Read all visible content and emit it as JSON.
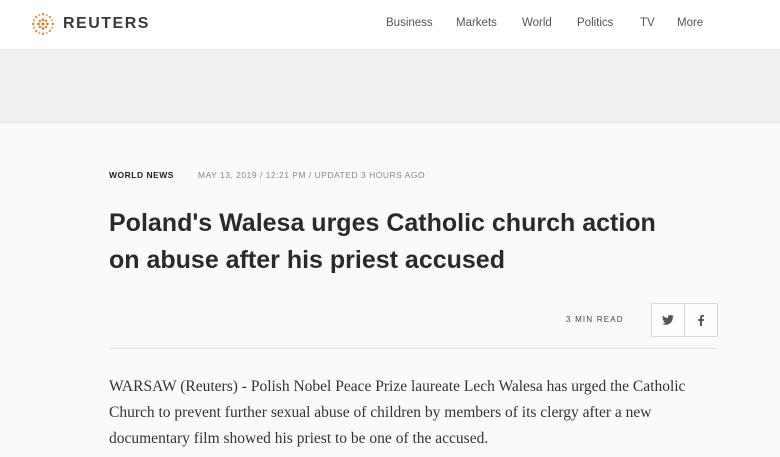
{
  "header": {
    "brand": "REUTERS",
    "nav": [
      "Business",
      "Markets",
      "World",
      "Politics",
      "TV",
      "More"
    ]
  },
  "article": {
    "section": "WORLD NEWS",
    "dateline": "MAY 13, 2019 / 12:21 PM / UPDATED 3 HOURS AGO",
    "headline": "Poland's Walesa urges Catholic church action on abuse after his priest accused",
    "read_time": "3 MIN READ",
    "share_icons": [
      "twitter-icon",
      "facebook-icon"
    ],
    "body": "WARSAW (Reuters) - Polish Nobel Peace Prize laureate Lech Walesa has urged the Catholic Church to prevent further sexual abuse of children by members of its clergy after a new documentary film showed his priest to be one of the accused."
  },
  "colors": {
    "brand_orange": "#e8812b",
    "header_bg": "#ffffff",
    "page_bg": "#fafafa",
    "ad_band_bg": "#f0f0f0",
    "text_dark": "#2a2a2a",
    "text_muted": "#888888"
  }
}
